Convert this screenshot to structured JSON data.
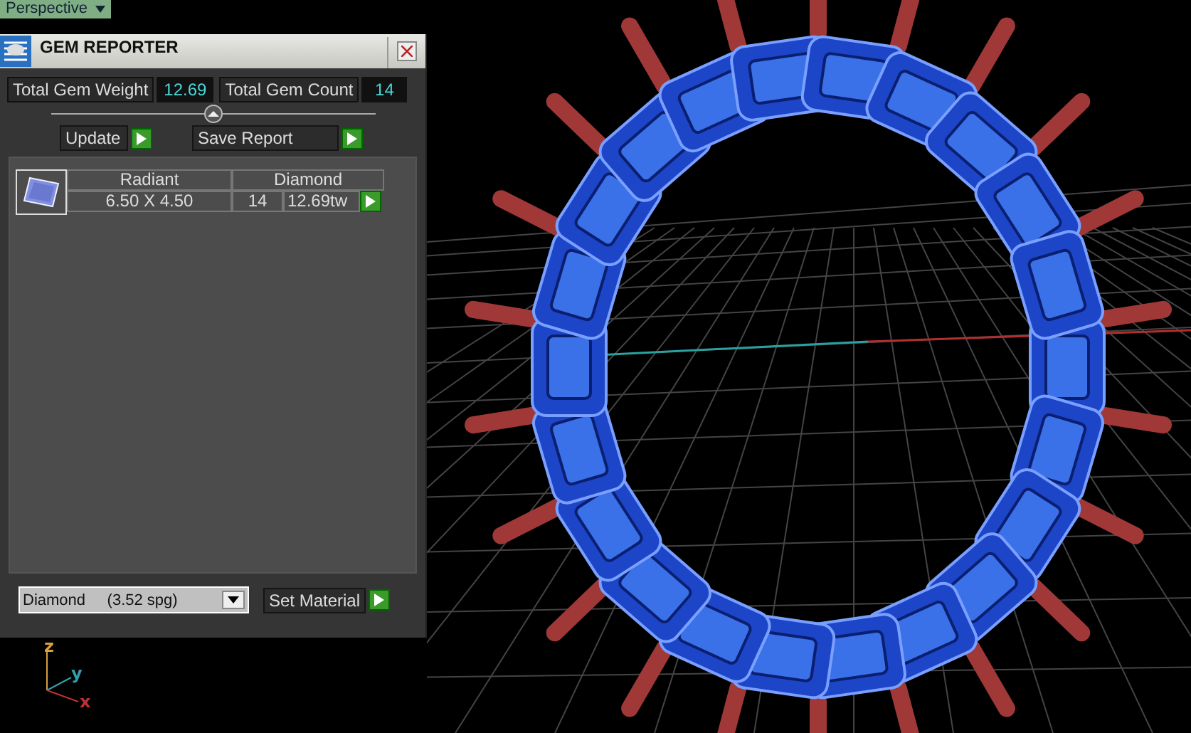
{
  "viewport_tab": {
    "label": "Perspective"
  },
  "panel": {
    "title": "GEM REPORTER",
    "stats": [
      {
        "label": "Total Gem Weight",
        "value": "12.69"
      },
      {
        "label": "Total Gem Count",
        "value": "14"
      }
    ],
    "buttons": [
      {
        "label": "Update"
      },
      {
        "label": "Save Report"
      }
    ],
    "gems": [
      {
        "shape": "Radiant",
        "material": "Diamond",
        "size": "6.50 X 4.50",
        "count": "14",
        "weight": "12.69tw"
      }
    ],
    "material_select": {
      "value": "Diamond     (3.52 spg)"
    },
    "set_button": {
      "label": "Set Material"
    }
  },
  "axes": [
    {
      "label": "z",
      "color": "#d8a040"
    },
    {
      "label": "y",
      "color": "#30a0b0"
    },
    {
      "label": "x",
      "color": "#c03030"
    }
  ]
}
